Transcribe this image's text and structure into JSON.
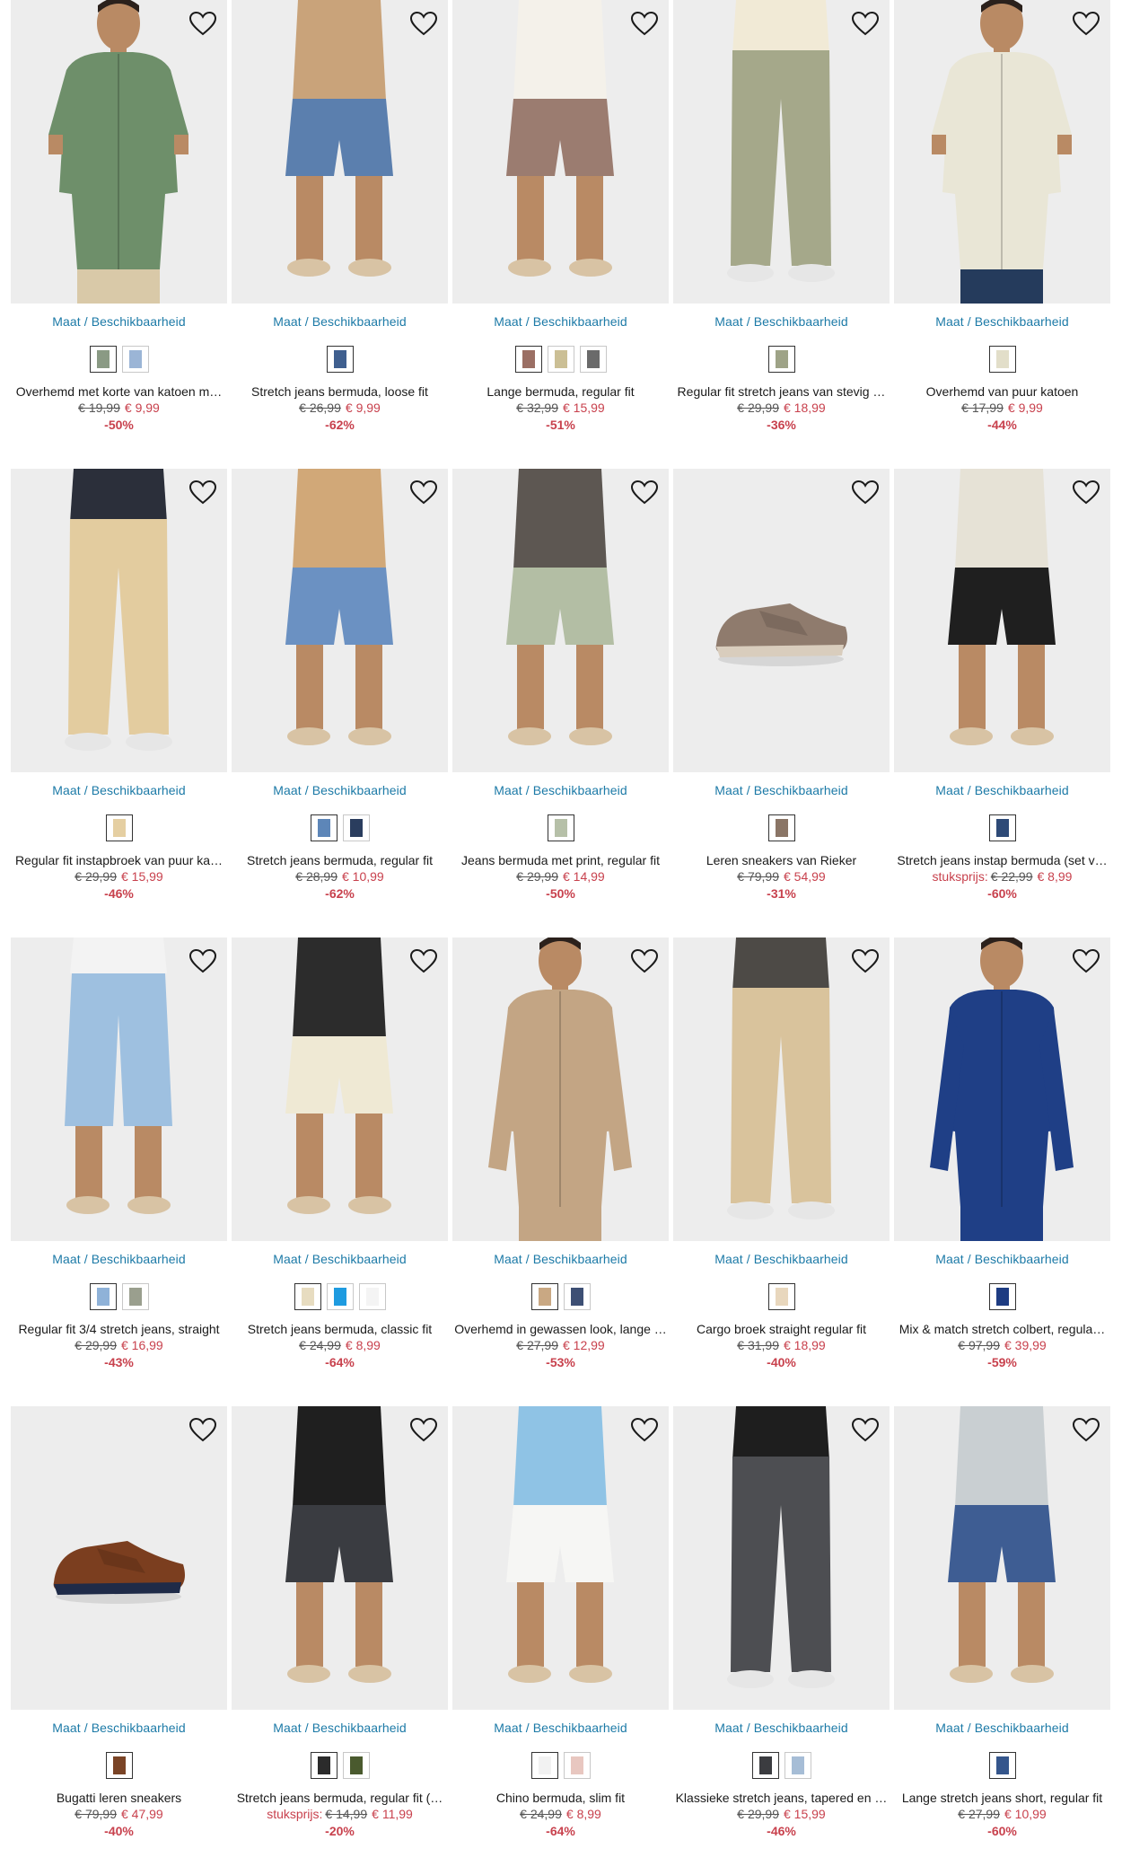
{
  "availability_label": "Maat / Beschikbaarheid",
  "accent_link_color": "#1c7aa7",
  "sale_color": "#c8414d",
  "products": [
    {
      "kind": "shirt",
      "top": "#6e8f6a",
      "bottom": "#d9c9a8",
      "name": "Overhemd met korte van katoen m…",
      "unit": "",
      "old": "€ 19,99",
      "new": "€ 9,99",
      "discount": "-50%",
      "swatches": [
        "#8a9a84",
        "#9bb5d6"
      ]
    },
    {
      "kind": "shorts",
      "top": "#c9a37a",
      "bottom": "#5b7fae",
      "name": "Stretch jeans bermuda, loose fit",
      "unit": "",
      "old": "€ 26,99",
      "new": "€ 9,99",
      "discount": "-62%",
      "swatches": [
        "#3f5f8f"
      ]
    },
    {
      "kind": "shorts",
      "top": "#f4f1ea",
      "bottom": "#9b7c70",
      "name": "Lange bermuda, regular fit",
      "unit": "",
      "old": "€ 32,99",
      "new": "€ 15,99",
      "discount": "-51%",
      "swatches": [
        "#9b6f64",
        "#cbbf95",
        "#6a6a6a"
      ]
    },
    {
      "kind": "pants",
      "top": "#f1ead6",
      "bottom": "#a5a88a",
      "name": "Regular fit stretch jeans van stevig …",
      "unit": "",
      "old": "€ 29,99",
      "new": "€ 18,99",
      "discount": "-36%",
      "swatches": [
        "#9ea387"
      ]
    },
    {
      "kind": "shirt",
      "top": "#e9e6d6",
      "bottom": "#253b5c",
      "name": "Overhemd van puur katoen",
      "unit": "",
      "old": "€ 17,99",
      "new": "€ 9,99",
      "discount": "-44%",
      "swatches": [
        "#e2dec9"
      ]
    },
    {
      "kind": "pants",
      "top": "#2b2f3a",
      "bottom": "#e3cc9f",
      "name": "Regular fit instapbroek van puur ka…",
      "unit": "",
      "old": "€ 29,99",
      "new": "€ 15,99",
      "discount": "-46%",
      "swatches": [
        "#e5cfa2"
      ]
    },
    {
      "kind": "shorts",
      "top": "#d1a878",
      "bottom": "#6b91c2",
      "name": "Stretch jeans bermuda, regular fit",
      "unit": "",
      "old": "€ 28,99",
      "new": "€ 10,99",
      "discount": "-62%",
      "swatches": [
        "#5d86b8",
        "#2a3d5e"
      ]
    },
    {
      "kind": "shorts",
      "top": "#5d5752",
      "bottom": "#b3bea4",
      "name": "Jeans bermuda met print, regular fit",
      "unit": "",
      "old": "€ 29,99",
      "new": "€ 14,99",
      "discount": "-50%",
      "swatches": [
        "#b6c0a8"
      ]
    },
    {
      "kind": "shoe",
      "top": "#8f7b6d",
      "bottom": "#d9cdbd",
      "name": "Leren sneakers van Rieker",
      "unit": "",
      "old": "€ 79,99",
      "new": "€ 54,99",
      "discount": "-31%",
      "swatches": [
        "#8a7566"
      ]
    },
    {
      "kind": "shorts",
      "top": "#e6e2d6",
      "bottom": "#1f1f1f",
      "name": "Stretch jeans instap bermuda (set v…",
      "unit": "stuksprijs:",
      "old": "€ 22,99",
      "new": "€ 8,99",
      "discount": "-60%",
      "swatches": [
        "#2e4a77"
      ]
    },
    {
      "kind": "capri",
      "top": "#f3f3f3",
      "bottom": "#9ec0e0",
      "name": "Regular fit 3/4 stretch jeans, straight",
      "unit": "",
      "old": "€ 29,99",
      "new": "€ 16,99",
      "discount": "-43%",
      "swatches": [
        "#8fb2d8",
        "#9a9f8e"
      ]
    },
    {
      "kind": "shorts",
      "top": "#2c2c2c",
      "bottom": "#efe9d4",
      "name": "Stretch jeans bermuda, classic fit",
      "unit": "",
      "old": "€ 24,99",
      "new": "€ 8,99",
      "discount": "-64%",
      "swatches": [
        "#e7dcc0",
        "#1e9be0",
        "#f4f4f4"
      ]
    },
    {
      "kind": "jacket",
      "top": "#c3a584",
      "bottom": "#c3a584",
      "name": "Overhemd in gewassen look, lange …",
      "unit": "",
      "old": "€ 27,99",
      "new": "€ 12,99",
      "discount": "-53%",
      "swatches": [
        "#c9a883",
        "#3d4f74"
      ]
    },
    {
      "kind": "pants",
      "top": "#4d4a46",
      "bottom": "#d9c39c",
      "name": "Cargo broek straight regular fit",
      "unit": "",
      "old": "€ 31,99",
      "new": "€ 18,99",
      "discount": "-40%",
      "swatches": [
        "#e8d7bd"
      ]
    },
    {
      "kind": "blazer",
      "top": "#1f3f86",
      "bottom": "#1f3f86",
      "name": "Mix & match stretch colbert, regula…",
      "unit": "",
      "old": "€ 97,99",
      "new": "€ 39,99",
      "discount": "-59%",
      "swatches": [
        "#1e3c82"
      ]
    },
    {
      "kind": "shoe",
      "top": "#7b3e1f",
      "bottom": "#1f2b48",
      "name": "Bugatti leren sneakers",
      "unit": "",
      "old": "€ 79,99",
      "new": "€ 47,99",
      "discount": "-40%",
      "swatches": [
        "#7a4426"
      ]
    },
    {
      "kind": "shorts",
      "top": "#1f1f1f",
      "bottom": "#3a3c41",
      "name": "Stretch jeans bermuda, regular fit (…",
      "unit": "stuksprijs:",
      "old": "€ 14,99",
      "new": "€ 11,99",
      "discount": "-20%",
      "swatches": [
        "#2b2b2b",
        "#4a5a2e"
      ]
    },
    {
      "kind": "shorts",
      "top": "#8fc3e5",
      "bottom": "#f6f6f4",
      "name": "Chino bermuda, slim fit",
      "unit": "",
      "old": "€ 24,99",
      "new": "€ 8,99",
      "discount": "-64%",
      "swatches": [
        "#f2f2f2",
        "#e8c7c0"
      ]
    },
    {
      "kind": "pants",
      "top": "#1e1e1e",
      "bottom": "#4d4e52",
      "name": "Klassieke stretch jeans, tapered en …",
      "unit": "",
      "old": "€ 29,99",
      "new": "€ 15,99",
      "discount": "-46%",
      "swatches": [
        "#3b3c40",
        "#a6bdd6"
      ]
    },
    {
      "kind": "shorts",
      "top": "#c9cfd2",
      "bottom": "#3e5d93",
      "name": "Lange stretch jeans short, regular fit",
      "unit": "",
      "old": "€ 27,99",
      "new": "€ 10,99",
      "discount": "-60%",
      "swatches": [
        "#35568c"
      ]
    }
  ]
}
